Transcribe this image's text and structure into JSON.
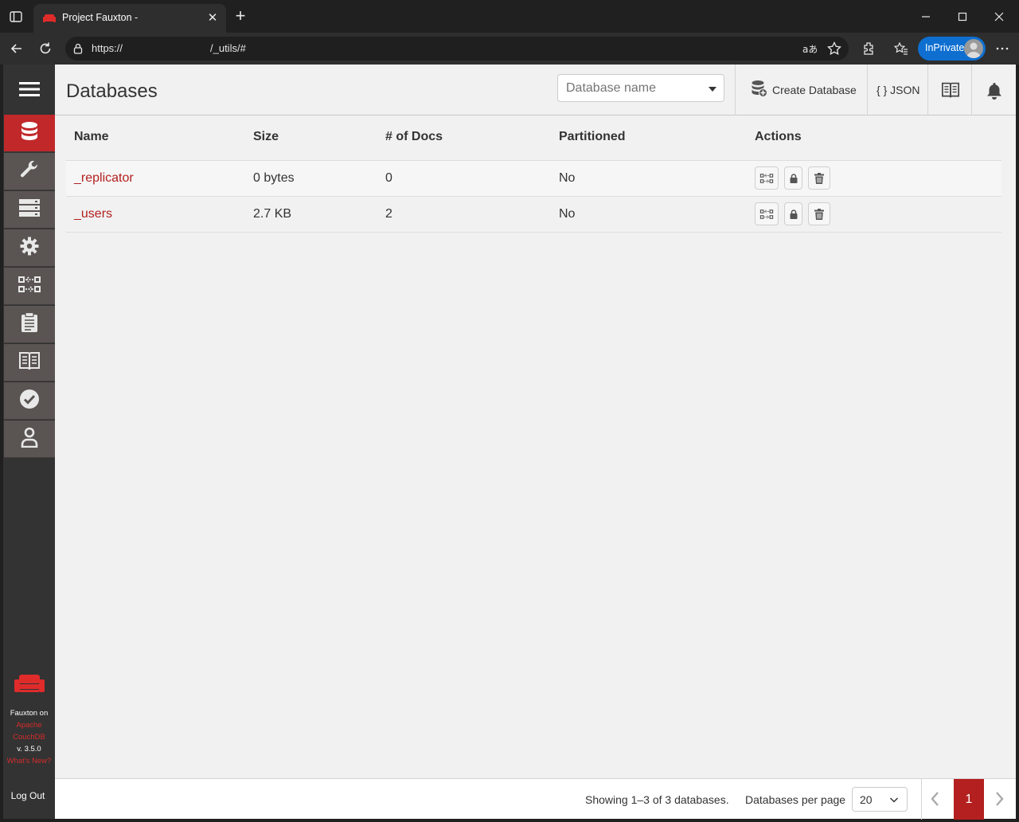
{
  "browser": {
    "tab_title": "Project Fauxton -",
    "url_scheme": "https://",
    "url_path": "/_utils/#",
    "profile_label": "InPrivate"
  },
  "sidebar": {
    "items": [
      {
        "name": "databases",
        "icon": "database-icon",
        "active": true
      },
      {
        "name": "setup",
        "icon": "wrench-icon",
        "active": false
      },
      {
        "name": "active-tasks",
        "icon": "server-icon",
        "active": false
      },
      {
        "name": "config",
        "icon": "gear-icon",
        "active": false
      },
      {
        "name": "replication",
        "icon": "replication-icon",
        "active": false
      },
      {
        "name": "logs",
        "icon": "clipboard-icon",
        "active": false
      },
      {
        "name": "documentation",
        "icon": "book-icon",
        "active": false
      },
      {
        "name": "verify",
        "icon": "check-circle-icon",
        "active": false
      },
      {
        "name": "user",
        "icon": "user-icon",
        "active": false
      }
    ],
    "brand_line1": "Fauxton on",
    "brand_line2": "Apache",
    "brand_line3": "CouchDB",
    "version": "v. 3.5.0",
    "whats_new": "What's New?",
    "logout": "Log Out"
  },
  "header": {
    "title": "Databases",
    "db_search_placeholder": "Database name",
    "create_database_label": "Create Database",
    "json_label": "{ } JSON"
  },
  "table": {
    "columns": [
      "Name",
      "Size",
      "# of Docs",
      "Partitioned",
      "Actions"
    ],
    "rows": [
      {
        "name": "_replicator",
        "size": "0 bytes",
        "docs": "0",
        "partitioned": "No"
      },
      {
        "name": "_users",
        "size": "2.7 KB",
        "docs": "2",
        "partitioned": "No"
      }
    ]
  },
  "footer": {
    "showing": "Showing 1–3 of 3 databases.",
    "per_page_label": "Databases per page",
    "per_page_value": "20",
    "current_page": "1"
  },
  "colors": {
    "accent_red": "#b3201f",
    "nav_active": "#c0282a",
    "nav_bg": "#333333",
    "inprivate_blue": "#0e6fd0"
  }
}
